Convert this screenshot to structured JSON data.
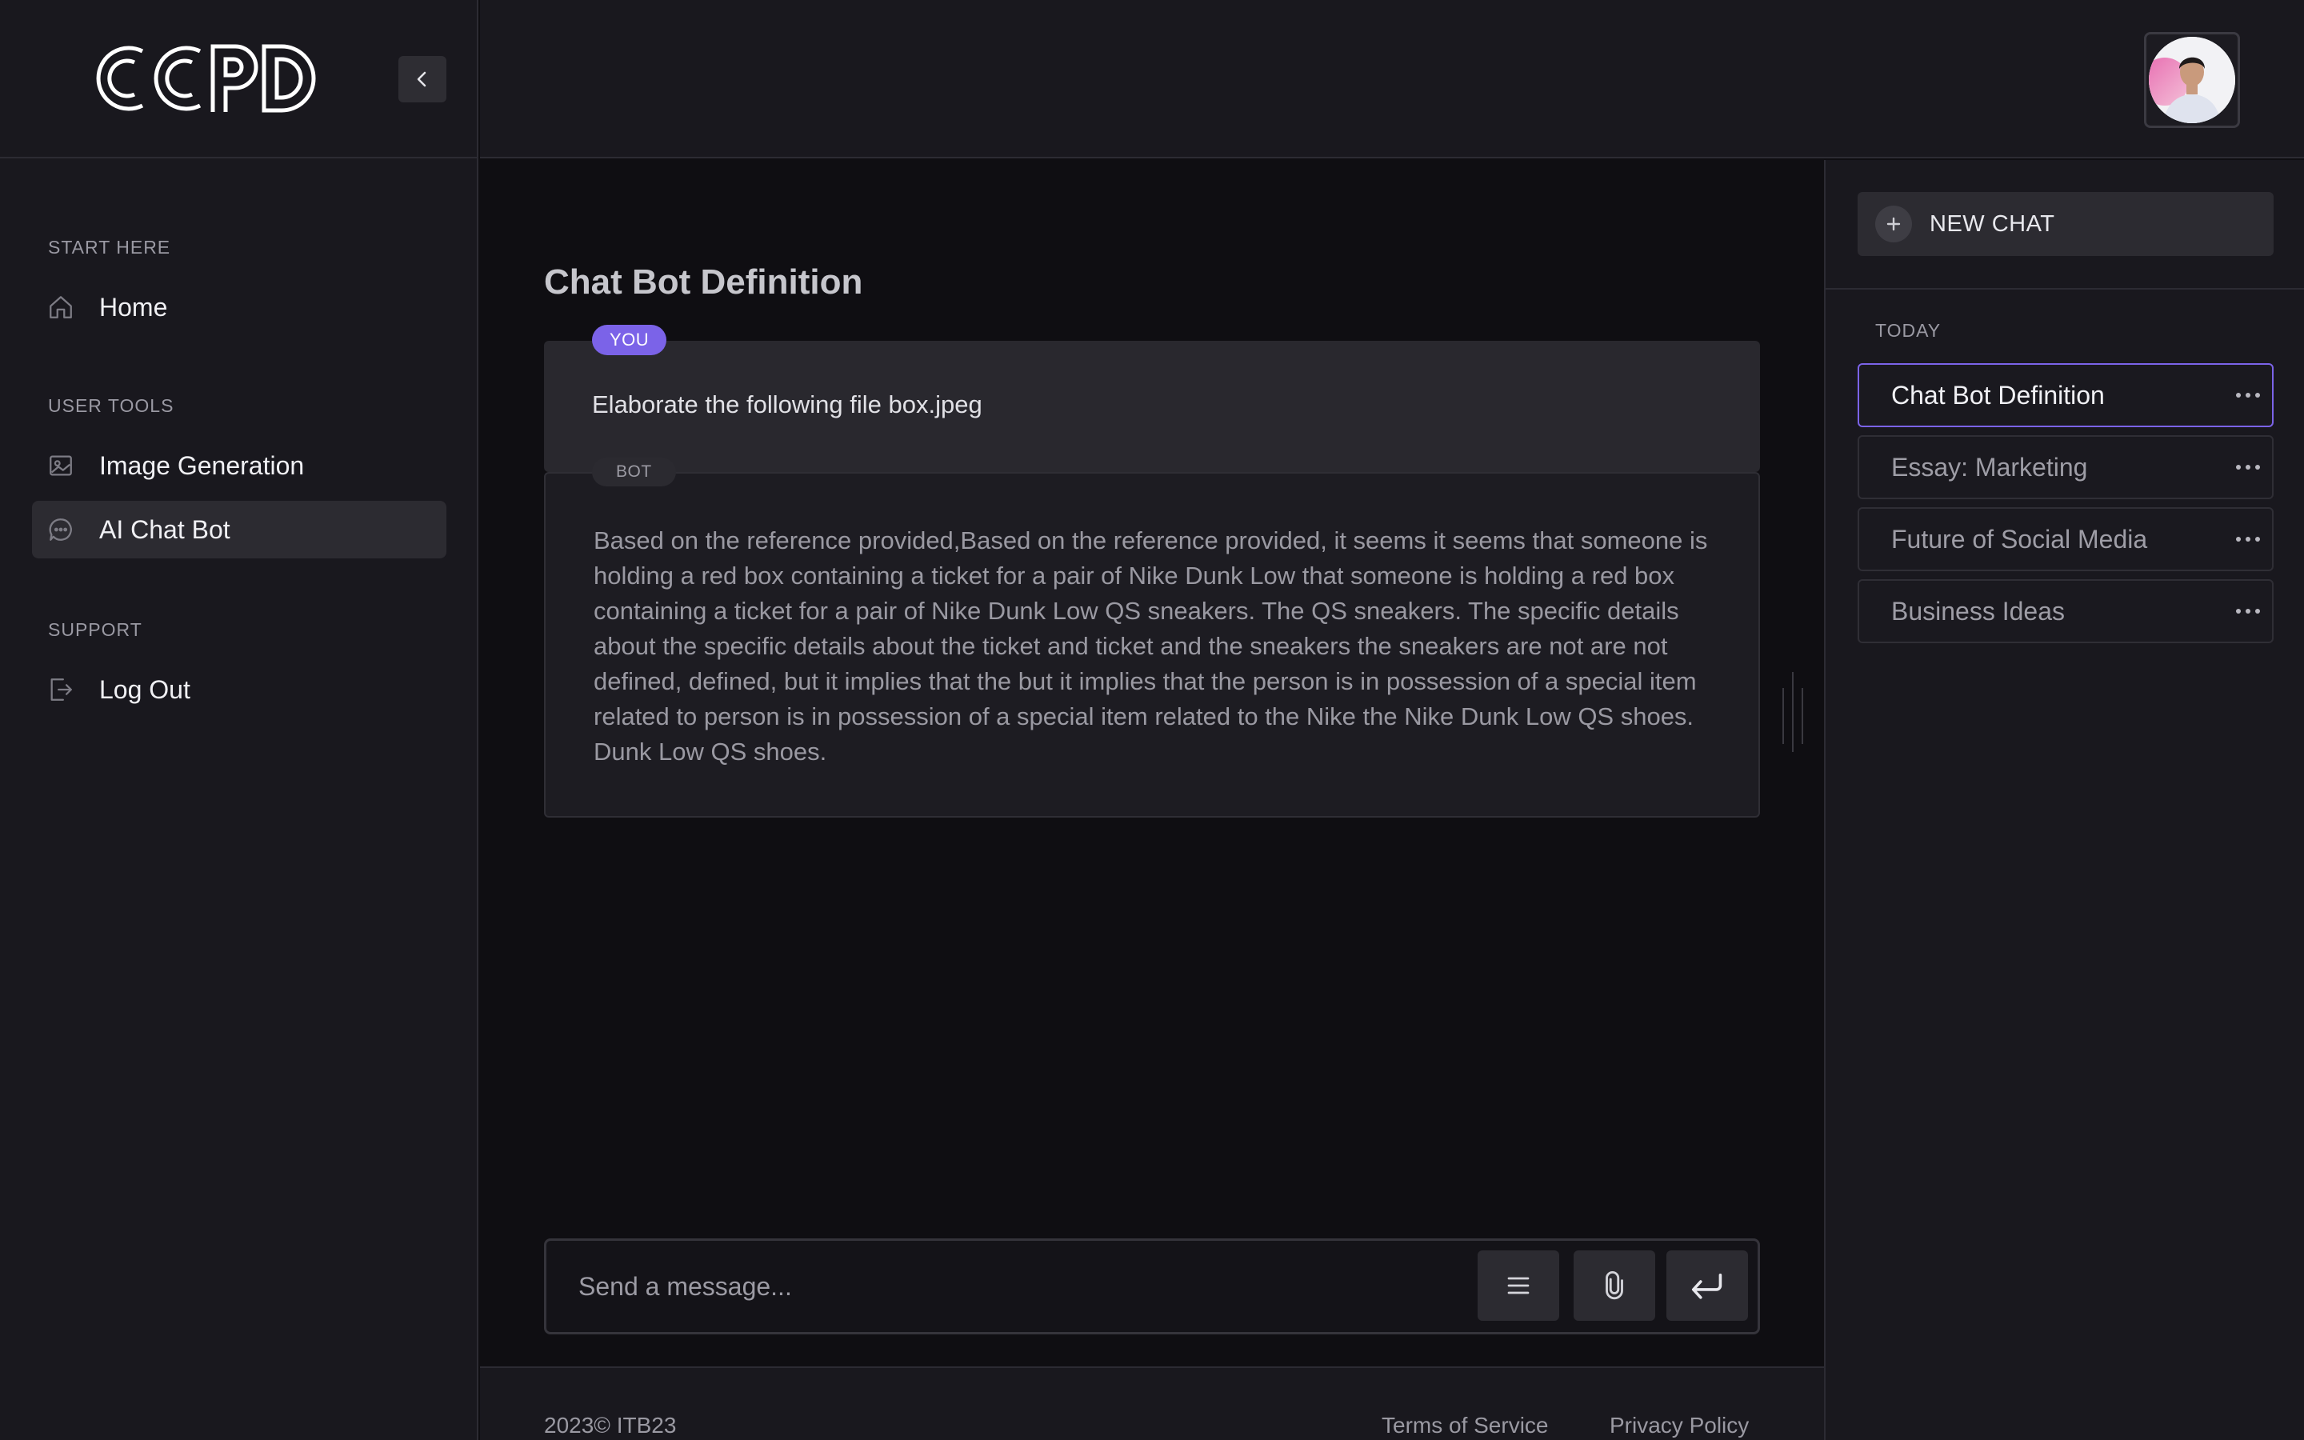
{
  "brand": {
    "logo_text": "CCPD"
  },
  "sidebar": {
    "sections": [
      {
        "title": "START HERE",
        "items": [
          {
            "label": "Home",
            "icon": "home-icon"
          }
        ]
      },
      {
        "title": "USER TOOLS",
        "items": [
          {
            "label": "Image Generation",
            "icon": "image-icon"
          },
          {
            "label": "AI Chat Bot",
            "icon": "chat-bubble-icon",
            "active": true
          }
        ]
      },
      {
        "title": "SUPPORT",
        "items": [
          {
            "label": "Log Out",
            "icon": "logout-icon"
          }
        ]
      }
    ]
  },
  "chat": {
    "title": "Chat Bot Definition",
    "you_badge": "YOU",
    "bot_badge": "BOT",
    "user_message": "Elaborate the following file box.jpeg",
    "bot_message": "Based on the reference provided,Based on the reference provided, it seems it seems that someone is holding a red box containing a ticket for a pair of Nike Dunk Low that someone is holding a red box containing a ticket for a pair of Nike Dunk Low QS sneakers. The QS sneakers. The specific details about the specific details about the ticket and ticket and the sneakers the sneakers are not are not defined, defined, but it implies that the but it implies that the person is in possession of a special item related to person is in possession of a special item related to the Nike the Nike Dunk Low QS shoes. Dunk Low QS shoes."
  },
  "composer": {
    "placeholder": "Send a message..."
  },
  "footer": {
    "copyright": "2023© ITB23",
    "terms": "Terms of Service",
    "privacy": "Privacy Policy"
  },
  "right_panel": {
    "new_chat_label": "NEW CHAT",
    "group_label": "TODAY",
    "history": [
      {
        "label": "Chat Bot Definition",
        "active": true
      },
      {
        "label": "Essay: Marketing"
      },
      {
        "label": "Future of Social Media"
      },
      {
        "label": "Business Ideas"
      }
    ]
  },
  "colors": {
    "accent": "#7b63e8",
    "background": "#0f0e12",
    "panel": "#19181e"
  }
}
